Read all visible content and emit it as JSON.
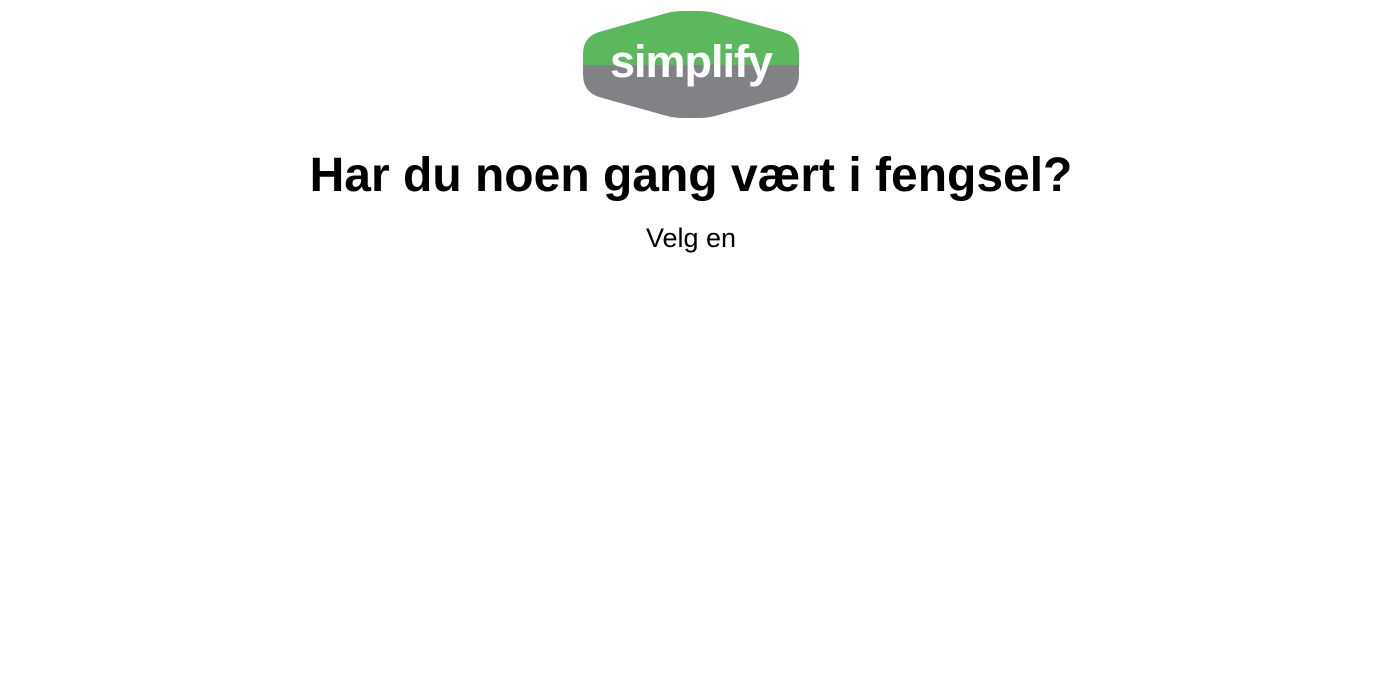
{
  "brand": {
    "logo_text": "simplify",
    "colors": {
      "top": "#5cb85c",
      "bottom": "#808285",
      "text": "#ffffff"
    }
  },
  "question": {
    "title": "Har du noen gang vært i fengsel?",
    "hint": "Velg en"
  }
}
